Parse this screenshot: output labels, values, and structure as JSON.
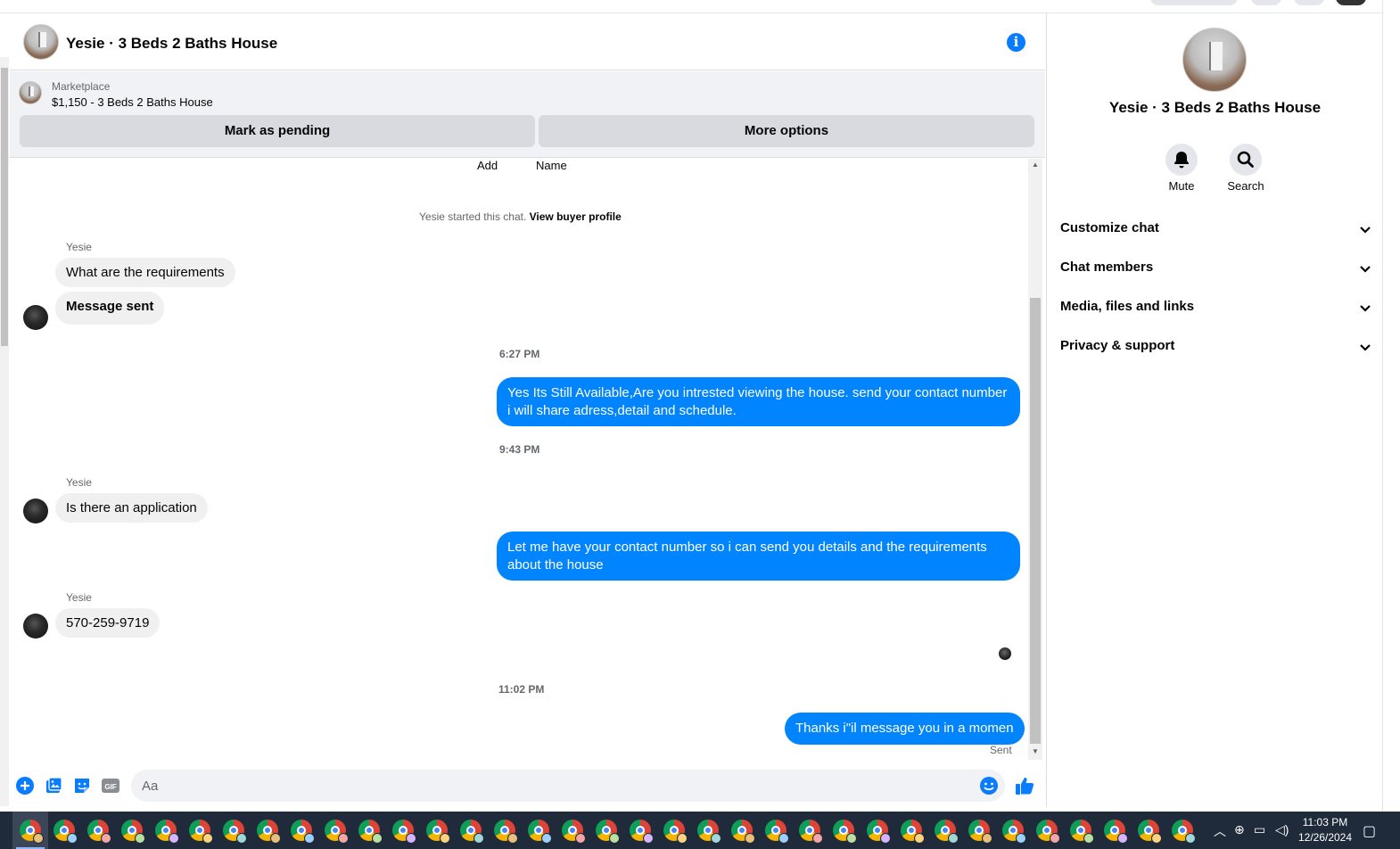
{
  "header": {
    "title": "Yesie · 3 Beds 2 Baths House"
  },
  "marketplace": {
    "label": "Marketplace",
    "item": "$1,150 - 3 Beds 2 Baths House",
    "mark_pending": "Mark as pending",
    "more_options": "More options"
  },
  "chat": {
    "top_actions": [
      "Add",
      "Name"
    ],
    "started_text": "Yesie started this chat.",
    "view_profile": "View buyer profile",
    "messages": [
      {
        "sender": "Yesie",
        "text": "What are the requirements"
      },
      {
        "text": "Message sent"
      },
      {
        "time": "6:27 PM"
      },
      {
        "text": "Yes Its Still Available,Are you intrested viewing the house. send your contact number i will share adress,detail and schedule."
      },
      {
        "time": "9:43 PM"
      },
      {
        "sender": "Yesie",
        "text": "Is there an application"
      },
      {
        "text": "Let me have your contact number so i can send you details and the requirements about the house"
      },
      {
        "sender": "Yesie",
        "text": "570-259-9719"
      },
      {
        "time": "11:02 PM"
      },
      {
        "text": "Thanks i\"il message you in a momen"
      }
    ],
    "status": "Sent"
  },
  "composer": {
    "placeholder": "Aa",
    "gif_label": "GIF"
  },
  "panel": {
    "name": "Yesie · 3 Beds 2 Baths House",
    "mute": "Mute",
    "search": "Search",
    "sections": [
      "Customize chat",
      "Chat members",
      "Media, files and links",
      "Privacy & support"
    ]
  },
  "taskbar": {
    "time": "11:03 PM",
    "date": "12/26/2024",
    "app_count": 35
  },
  "colors": {
    "accent": "#0084ff",
    "bubble_in": "#f0f0f0",
    "taskbar": "#1f2a3a"
  },
  "icons": [
    "info-icon",
    "plus-icon",
    "photo-icon",
    "sticker-icon",
    "gif-icon",
    "emoji-icon",
    "thumbs-up-icon",
    "bell-icon",
    "search-icon",
    "chevron-down-icon"
  ]
}
